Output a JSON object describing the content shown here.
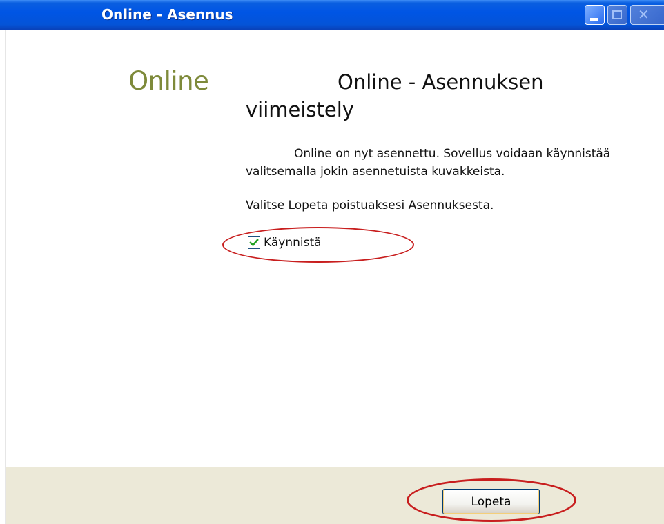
{
  "window": {
    "title": "Online - Asennus",
    "controls": [
      "minimize-icon",
      "maximize-icon",
      "close-icon"
    ]
  },
  "installer": {
    "logo_text": "Online",
    "heading": "Online - Asennuksen viimeistely",
    "paragraph1": "Online on nyt asennettu. Sovellus voidaan käynnistää valitsemalla jokin asennetuista kuvakkeista.",
    "paragraph2": "Valitse Lopeta poistuaksesi Asennuksesta.",
    "launch_checkbox": {
      "label": "Käynnistä",
      "checked": true
    }
  },
  "footer": {
    "finish_label": "Lopeta"
  },
  "colors": {
    "titlebar": "#0055e5",
    "logo": "#7e8a3a",
    "highlight_ellipse": "#c81e1e",
    "footer_bg": "#ece9d8"
  }
}
